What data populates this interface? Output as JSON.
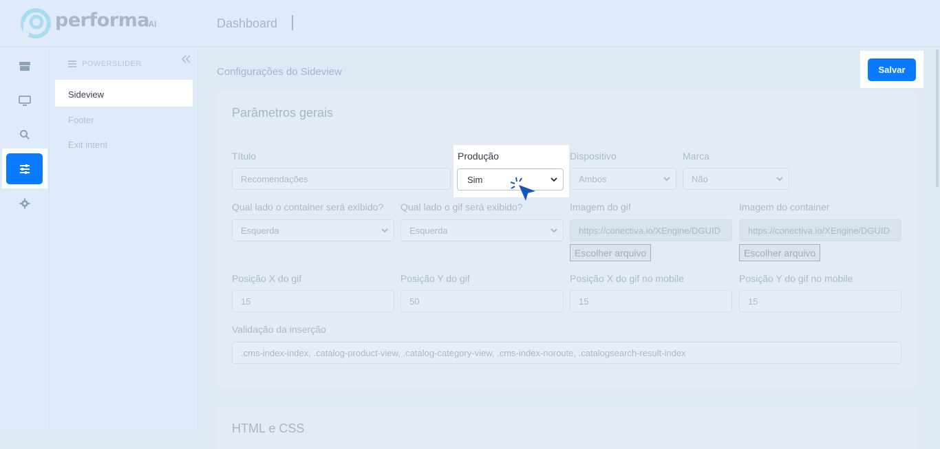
{
  "brand": {
    "name": "performa",
    "suffix": ".AI",
    "accent": "#0a7bff"
  },
  "header": {
    "page_title": "Dashboard"
  },
  "rail": {
    "items": [
      {
        "icon": "store-icon"
      },
      {
        "icon": "monitor-icon"
      },
      {
        "icon": "search-icon"
      },
      {
        "icon": "sliders-icon",
        "active": true
      },
      {
        "icon": "gear-icon"
      }
    ]
  },
  "subnav": {
    "title": "POWERSLIDER",
    "items": [
      {
        "label": "Sideview",
        "active": true
      },
      {
        "label": "Footer"
      },
      {
        "label": "Exit intent"
      }
    ]
  },
  "main": {
    "title": "Configurações do Sideview",
    "save_label": "Salvar",
    "section_general": "Parâmetros gerais",
    "section_html": "HTML e CSS",
    "fields": {
      "titulo": {
        "label": "Título",
        "value": "Recomendações"
      },
      "producao": {
        "label": "Produção",
        "value": "Sim"
      },
      "dispositivo": {
        "label": "Dispositivo",
        "value": "Ambos"
      },
      "marca": {
        "label": "Marca",
        "value": "Não"
      },
      "lado_container": {
        "label": "Qual lado o container será exibido?",
        "value": "Esquerda"
      },
      "lado_gif": {
        "label": "Qual lado o gif será exibido?",
        "value": "Esquerda"
      },
      "imagem_gif": {
        "label": "Imagem do gif",
        "value": "https://conectiva.io/XEngine/DGUID",
        "button": "Escolher arquivo"
      },
      "imagem_container": {
        "label": "Imagem do container",
        "value": "https://conectiva.io/XEngine/DGUID",
        "button": "Escolher arquivo"
      },
      "pos_x_gif": {
        "label": "Posição X do gif",
        "value": "15"
      },
      "pos_y_gif": {
        "label": "Posição Y do gif",
        "value": "50"
      },
      "pos_x_gif_mobile": {
        "label": "Posição X do gif no mobile",
        "value": "15"
      },
      "pos_y_gif_mobile": {
        "label": "Posição Y do gif no mobile",
        "value": "15"
      },
      "validacao": {
        "label": "Validação da inserção",
        "value": ".cms-index-index, .catalog-product-view, .catalog-category-view, .cms-index-noroute, .catalogsearch-result-index"
      }
    }
  }
}
